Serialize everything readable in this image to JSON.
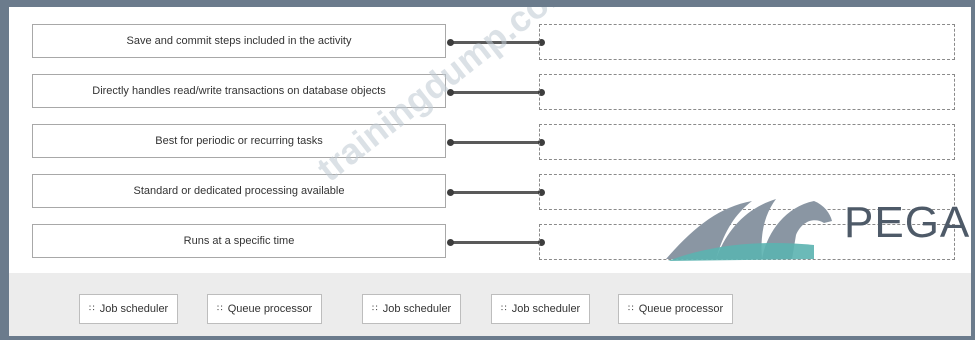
{
  "rows": [
    {
      "label": "Save and commit steps included in the activity"
    },
    {
      "label": "Directly handles read/write transactions on database objects"
    },
    {
      "label": "Best for periodic or recurring tasks"
    },
    {
      "label": "Standard or dedicated processing available"
    },
    {
      "label": "Runs at a specific time"
    }
  ],
  "options": [
    {
      "label": "Job scheduler",
      "icon": "drag-handle-icon"
    },
    {
      "label": "Queue processor",
      "icon": "drag-handle-icon"
    },
    {
      "label": "Job scheduler",
      "icon": "drag-handle-icon"
    },
    {
      "label": "Job scheduler",
      "icon": "drag-handle-icon"
    },
    {
      "label": "Queue processor",
      "icon": "drag-handle-icon"
    }
  ],
  "watermark": "trainingdump.com",
  "logo": {
    "text": "PEGA"
  },
  "colors": {
    "frame": "#6b7b8c",
    "connector": "#5a5a5a",
    "tray": "#ececec",
    "logo_teal": "#5bb3b0",
    "logo_gray": "#8a96a3"
  }
}
